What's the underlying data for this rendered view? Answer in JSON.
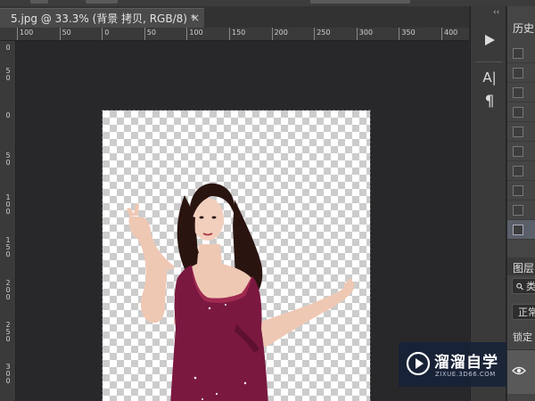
{
  "document": {
    "tab_title": "5.jpg @ 33.3% (背景 拷贝, RGB/8) *",
    "close_glyph": "×"
  },
  "rulers": {
    "horizontal": [
      "100",
      "50",
      "0",
      "50",
      "100",
      "150",
      "200",
      "250",
      "300",
      "350",
      "400"
    ],
    "vertical": [
      "0",
      "50",
      "0",
      "50",
      "100",
      "150",
      "200",
      "250",
      "300"
    ]
  },
  "toolstrip": {
    "collapse_glyph": "‹‹",
    "tools": [
      {
        "name": "play-action",
        "icon": "play-icon"
      },
      {
        "name": "character",
        "icon": "character-icon",
        "text": "A|"
      },
      {
        "name": "paragraph",
        "icon": "paragraph-icon",
        "text": "¶"
      }
    ]
  },
  "history": {
    "title": "历史",
    "row_count": 10,
    "selected_index": 9
  },
  "layers": {
    "title": "图层",
    "search_text": "类",
    "blend_mode": "正常",
    "lock_label": "锁定"
  },
  "watermark": {
    "brand": "溜溜自学",
    "url": "ZIXUE.3D66.COM"
  },
  "colors": {
    "workspace": "#28282a",
    "panel": "#454545",
    "dress": "#7a1840",
    "skin": "#efc8b4"
  }
}
